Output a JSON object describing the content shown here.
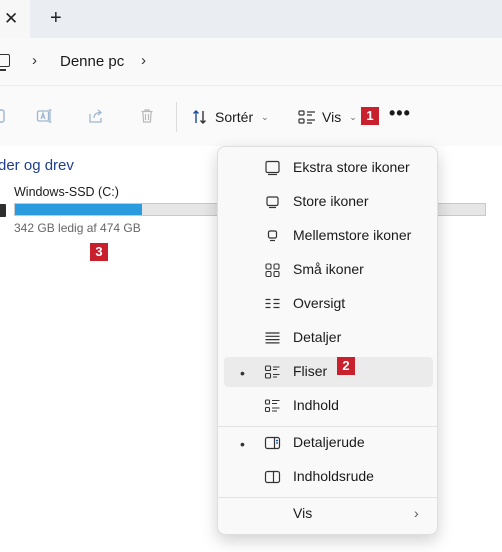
{
  "tabbar": {
    "close_glyph": "✕",
    "newtab_glyph": "+"
  },
  "address": {
    "location": "Denne pc",
    "chevron": "›"
  },
  "toolbar": {
    "icons": [
      "rename-icon",
      "share-icon",
      "delete-icon"
    ],
    "sort_label": "Sortér",
    "view_label": "Vis",
    "dropdown_glyph": "⌄",
    "more_glyph": "•••"
  },
  "badges": {
    "b1": "1",
    "b2": "2",
    "b3": "3"
  },
  "content": {
    "section_title": "der og drev",
    "drive": {
      "name": "Windows-SSD (C:)",
      "free_text": "342 GB ledig af 474 GB",
      "used_fraction": 0.27,
      "bar_color": "#2b9be0"
    }
  },
  "menu": {
    "items": [
      {
        "label": "Ekstra store ikoner",
        "icon": "extra-large-icons-icon"
      },
      {
        "label": "Store ikoner",
        "icon": "large-icons-icon"
      },
      {
        "label": "Mellemstore ikoner",
        "icon": "medium-icons-icon"
      },
      {
        "label": "Små ikoner",
        "icon": "small-icons-icon"
      },
      {
        "label": "Oversigt",
        "icon": "list-icon"
      },
      {
        "label": "Detaljer",
        "icon": "details-icon"
      },
      {
        "label": "Fliser",
        "icon": "tiles-icon",
        "selected": true,
        "bullet": "•"
      },
      {
        "label": "Indhold",
        "icon": "content-icon"
      },
      {
        "label": "Detaljerude",
        "icon": "details-pane-icon",
        "bullet": "•"
      },
      {
        "label": "Indholdsrude",
        "icon": "preview-pane-icon"
      },
      {
        "label": "Vis",
        "submenu_arrow": "›"
      }
    ]
  },
  "colors": {
    "accent": "#2b9be0",
    "badge": "#c8202c",
    "section_title": "#1f3f8f"
  }
}
